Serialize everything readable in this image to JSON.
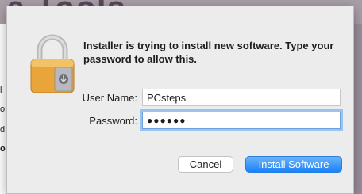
{
  "background": {
    "title_fragment": "e Tools",
    "side_fragments": [
      "l",
      "o",
      "d",
      "o"
    ]
  },
  "dialog": {
    "message": "Installer is trying to install new software. Type your password to allow this.",
    "lock_icon": "padlock-installer-icon",
    "username_label": "User Name:",
    "username_value": "PCsteps",
    "password_label": "Password:",
    "password_value": "●●●●●●",
    "cancel_label": "Cancel",
    "install_label": "Install Software"
  },
  "colors": {
    "accent": "#1a82fb",
    "dialog_bg": "#ececec",
    "lock_gold": "#e9a53a"
  }
}
